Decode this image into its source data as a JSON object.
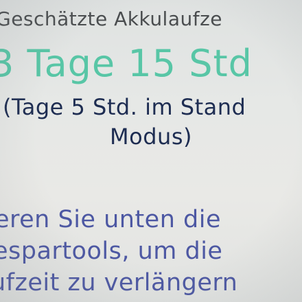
{
  "battery": {
    "heading": "Geschätzte Akkulaufze",
    "estimate": "3 Tage 15 Std",
    "standby_line1": "(Tage 5 Std. im Stand",
    "standby_line2": "Modus)",
    "hint_line1": "eren Sie unten die",
    "hint_line2": "espartools, um die",
    "hint_line3": "ufzeit zu verlängern"
  },
  "colors": {
    "accent": "#58c6a6",
    "heading": "#4a4d4f",
    "standby_text": "#1e2d52",
    "hint_text": "#4d58a3",
    "background": "#e6e8e6"
  }
}
